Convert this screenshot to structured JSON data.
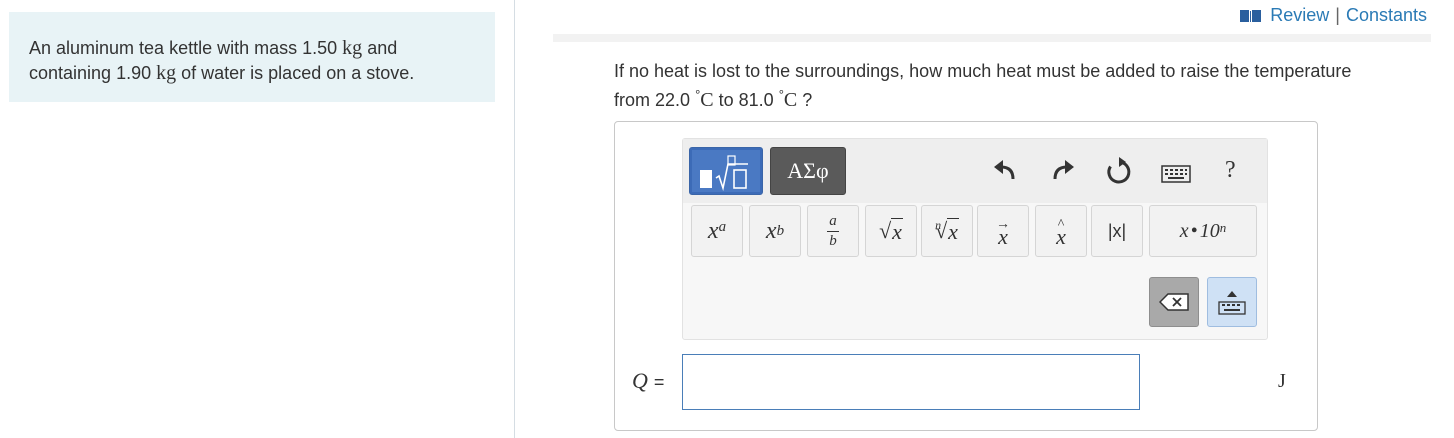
{
  "problem": {
    "line1_pre": "An aluminum tea kettle with mass 1.50",
    "line1_unit": "kg",
    "line1_post": "and",
    "line2_pre": "containing 1.90",
    "line2_unit": "kg",
    "line2_post": "of water is placed on a stove."
  },
  "links": {
    "review": "Review",
    "separator": "|",
    "constants": "Constants"
  },
  "question": {
    "line1": "If no heat is lost to the surroundings, how much heat must be added to raise the temperature",
    "line2_pre": "from 22.0",
    "deg": "°",
    "unit": "C",
    "mid": "to 81.0",
    "end": "?"
  },
  "toolbar": {
    "greek_label": "ΑΣφ",
    "help_label": "?",
    "buttons": {
      "superscript_base": "x",
      "superscript_exp": "a",
      "subscript_base": "x",
      "subscript_sub": "b",
      "frac_num": "a",
      "frac_den": "b",
      "sqrt_arg": "x",
      "nthroot_index": "n",
      "nthroot_arg": "x",
      "vector": "x",
      "unitvector": "x",
      "abs": "|x|",
      "sci_x": "x",
      "sci_dot": "•",
      "sci_base": "10",
      "sci_exp": "n"
    }
  },
  "answer": {
    "variable": "Q",
    "equals": "=",
    "value": "",
    "unit": "J"
  }
}
